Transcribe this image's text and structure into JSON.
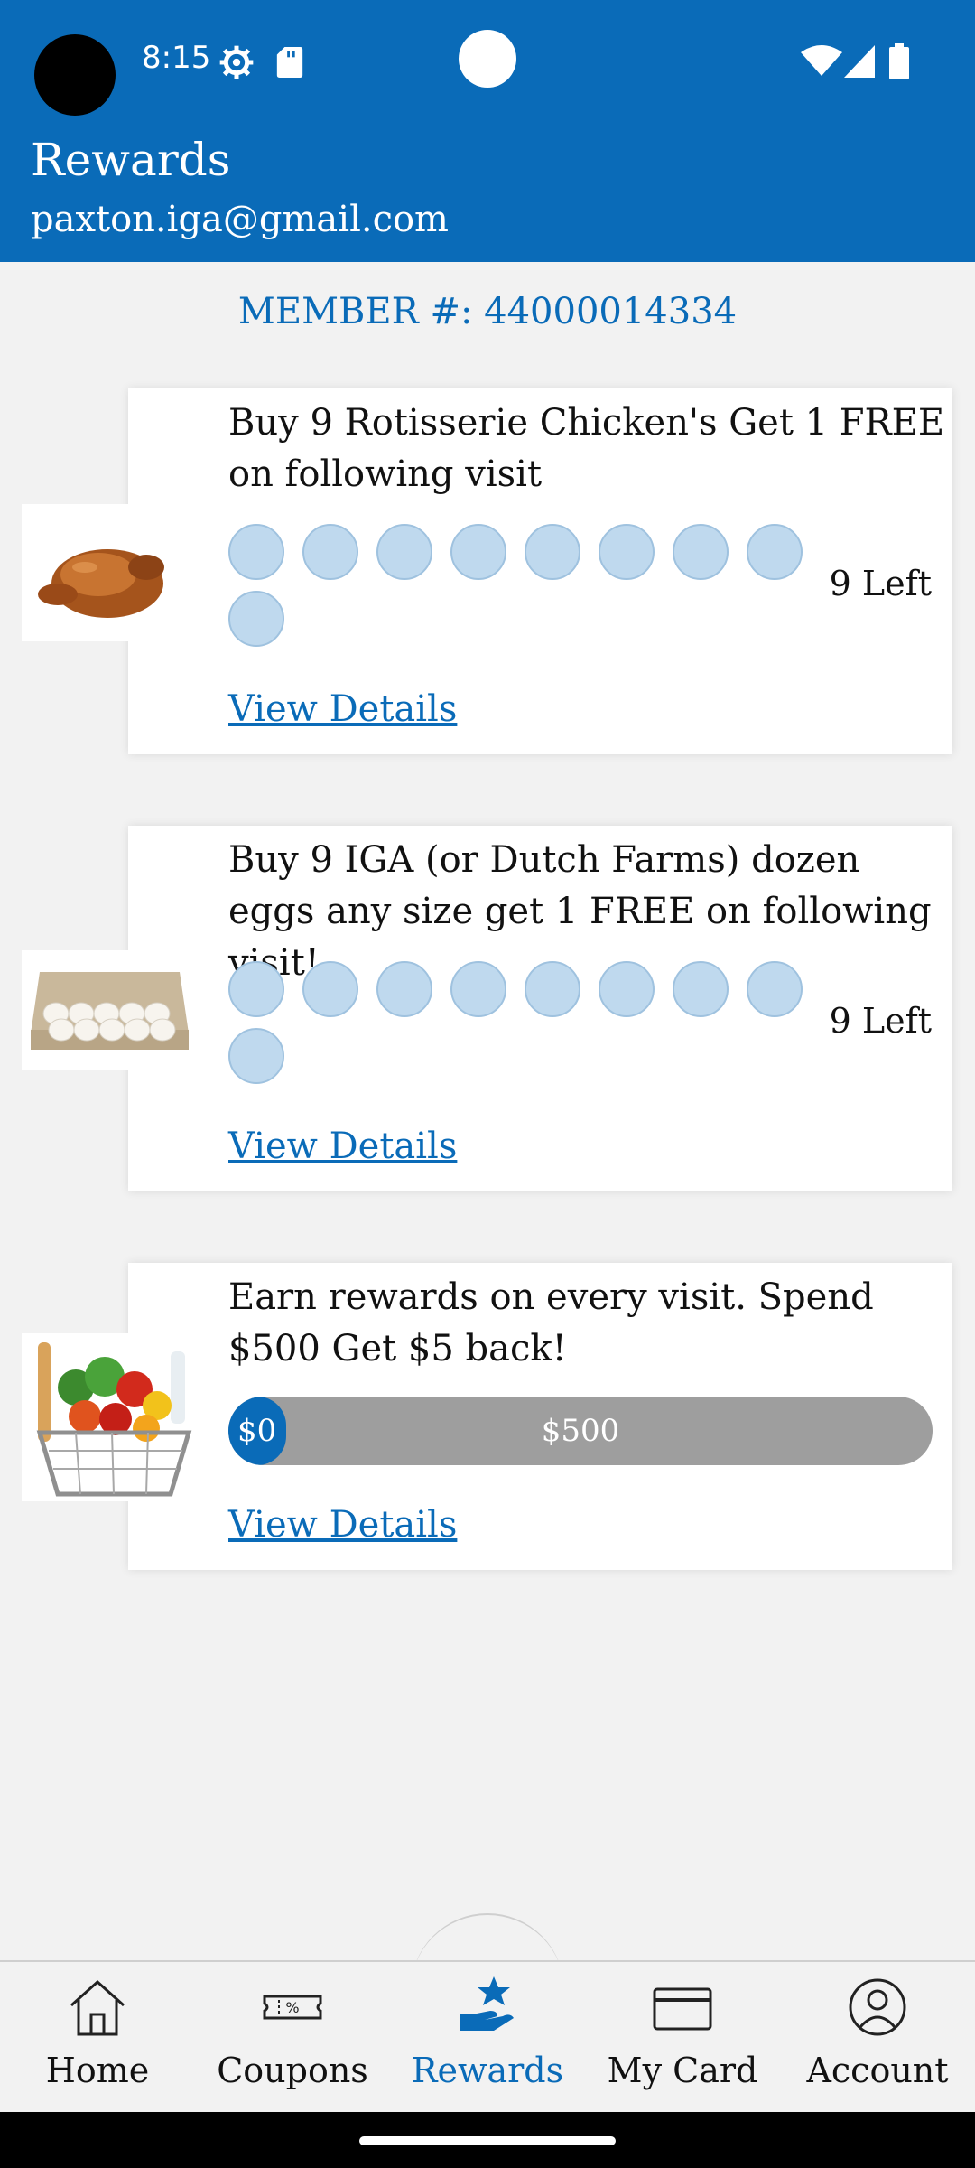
{
  "status_bar": {
    "time": "8:15"
  },
  "header": {
    "title": "Rewards",
    "subtitle": "paxton.iga@gmail.com"
  },
  "member": {
    "text": "MEMBER #: 44000014334"
  },
  "rewards": [
    {
      "title": "Buy 9 Rotisserie Chicken's Get 1 FREE on following visit",
      "stamps_total": 9,
      "stamps_filled": 0,
      "remaining": "9 Left",
      "link": "View Details",
      "image_icon": "rotisserie-chicken"
    },
    {
      "title": "Buy 9 IGA (or Dutch Farms) dozen eggs any size get 1 FREE on following visit!",
      "stamps_total": 9,
      "stamps_filled": 0,
      "remaining": "9 Left",
      "link": "View Details",
      "image_icon": "egg-carton"
    },
    {
      "title": "Earn rewards on every visit. Spend $500 Get $5 back!",
      "progress_start": "$0",
      "progress_goal": "$500",
      "progress_fraction": 0.0,
      "link": "View Details",
      "image_icon": "grocery-basket"
    }
  ],
  "nav": {
    "items": [
      {
        "label": "Home",
        "icon": "home-icon"
      },
      {
        "label": "Coupons",
        "icon": "coupon-icon"
      },
      {
        "label": "Rewards",
        "icon": "rewards-icon",
        "active": true
      },
      {
        "label": "My Card",
        "icon": "card-icon"
      },
      {
        "label": "Account",
        "icon": "account-icon"
      }
    ]
  },
  "colors": {
    "brand": "#0a6bb8",
    "stamp": "#bfd9ee",
    "progress_track": "#9e9e9e"
  }
}
